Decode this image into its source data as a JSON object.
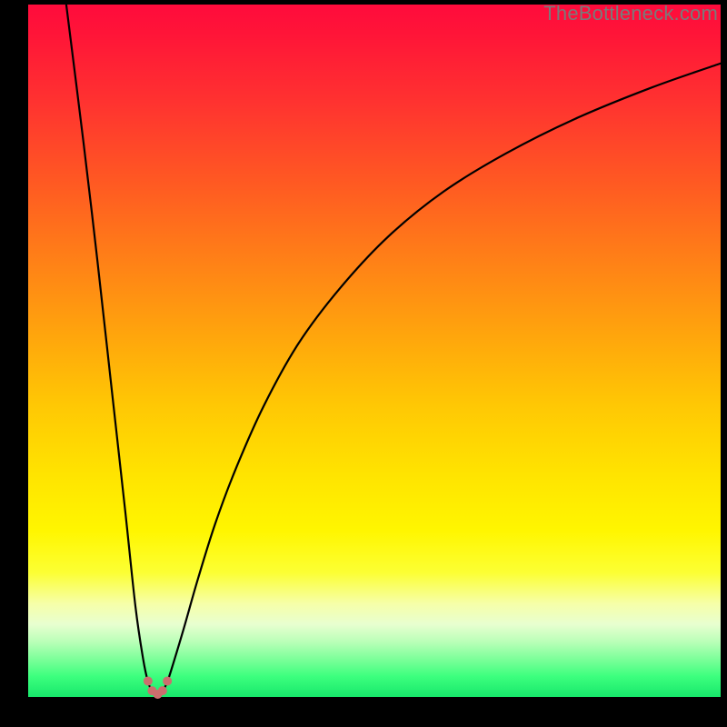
{
  "watermark": "TheBottleneck.com",
  "colors": {
    "frame": "#000000",
    "curve": "#000000",
    "marker": "#cc6e6e",
    "gradient_top": "#ff0b3c",
    "gradient_bottom": "#17e86b"
  },
  "chart_data": {
    "type": "line",
    "title": "",
    "xlabel": "",
    "ylabel": "",
    "xlim": [
      0,
      100
    ],
    "ylim": [
      0,
      100
    ],
    "grid": false,
    "legend": false,
    "notes": "V-shaped bottleneck curve on a red-to-green vertical gradient background. No axis ticks or labels are shown; x and y are normalized 0–100. Left branch descends steeply from top to the minimum near x≈18; right branch rises with decreasing slope toward the top-right. A small cluster of salmon-colored markers sits at the valley bottom.",
    "series": [
      {
        "name": "left-branch",
        "x": [
          5.5,
          8,
          10,
          12,
          14,
          15.5,
          16.6,
          17.3,
          17.9
        ],
        "y": [
          100,
          80,
          63,
          45,
          27,
          13,
          5.5,
          2.2,
          0.8
        ]
      },
      {
        "name": "right-branch",
        "x": [
          19.4,
          20.1,
          21,
          22.5,
          24.5,
          27,
          30,
          34,
          39,
          45,
          52,
          60,
          69,
          79,
          90,
          100
        ],
        "y": [
          0.8,
          2.2,
          5,
          10,
          17,
          25,
          33,
          42,
          51,
          59,
          66.5,
          73,
          78.5,
          83.5,
          88,
          91.5
        ]
      }
    ],
    "markers": {
      "name": "valley-points",
      "color": "#cc6e6e",
      "radius_px": 5,
      "points": [
        {
          "x": 17.3,
          "y": 2.3
        },
        {
          "x": 17.9,
          "y": 0.9
        },
        {
          "x": 18.7,
          "y": 0.4
        },
        {
          "x": 19.4,
          "y": 0.9
        },
        {
          "x": 20.1,
          "y": 2.3
        }
      ]
    }
  }
}
